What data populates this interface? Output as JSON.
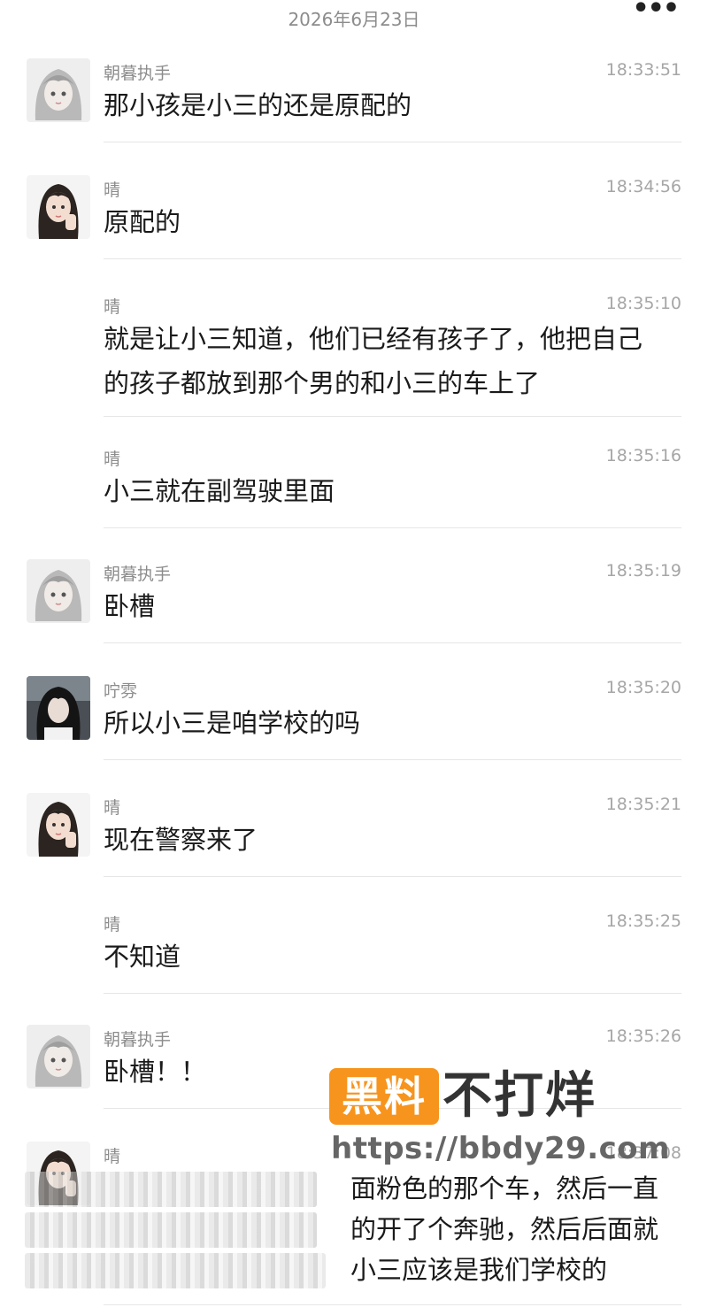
{
  "header": {
    "date": "2026年6月23日",
    "menu_icon": "more-dots-icon"
  },
  "messages": [
    {
      "sender": "朝暮执手",
      "time": "18:33:51",
      "lines": [
        "那小孩是小三的还是原配的"
      ],
      "avatar": "gray-anime-avatar"
    },
    {
      "sender": "晴",
      "time": "18:34:56",
      "lines": [
        "原配的"
      ],
      "avatar": "girl-photo-avatar"
    },
    {
      "sender": "晴",
      "time": "18:35:10",
      "lines": [
        "就是让小三知道，他们已经有孩子了，他把自己",
        "的孩子都放到那个男的和小三的车上了"
      ],
      "avatar": ""
    },
    {
      "sender": "晴",
      "time": "18:35:16",
      "lines": [
        "小三就在副驾驶里面"
      ],
      "avatar": ""
    },
    {
      "sender": "朝暮执手",
      "time": "18:35:19",
      "lines": [
        "卧槽"
      ],
      "avatar": "gray-anime-avatar"
    },
    {
      "sender": "咛雰",
      "time": "18:35:20",
      "lines": [
        "所以小三是咱学校的吗"
      ],
      "avatar": "dark-hair-avatar"
    },
    {
      "sender": "晴",
      "time": "18:35:21",
      "lines": [
        "现在警察来了"
      ],
      "avatar": "girl-photo-avatar"
    },
    {
      "sender": "晴",
      "time": "18:35:25",
      "lines": [
        "不知道"
      ],
      "avatar": ""
    },
    {
      "sender": "朝暮执手",
      "time": "18:35:26",
      "lines": [
        "卧槽！！"
      ],
      "avatar": "gray-anime-avatar"
    },
    {
      "sender": "晴",
      "time": "18:37:08",
      "lines": [
        "面粉色的那个车，然后一直",
        "的开了个奔驰，然后后面就",
        "小三应该是我们学校的"
      ],
      "avatar": "girl-photo-avatar"
    }
  ],
  "watermark": {
    "badge": "黑料",
    "title": "不打烊",
    "url": "https://bbdy29.com",
    "badge_color": "#f7941d"
  }
}
